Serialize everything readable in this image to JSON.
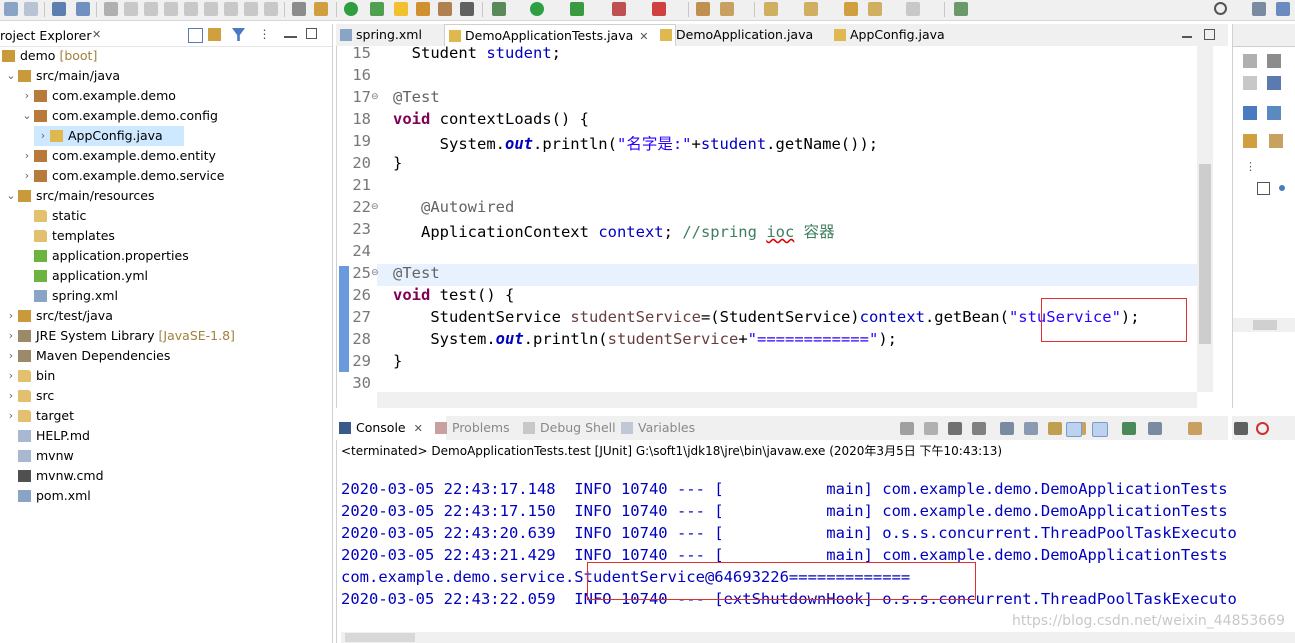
{
  "project_explorer": {
    "title": "roject Explorer",
    "tree": [
      {
        "label": "demo",
        "extra": "[boot]",
        "icon": "project-icon",
        "chev": "⌄"
      },
      {
        "label": "src/main/java",
        "extra": "",
        "icon": "source-folder-icon",
        "chev": "⌄"
      },
      {
        "label": "com.example.demo",
        "extra": "",
        "icon": "package-icon",
        "chev": "›"
      },
      {
        "label": "com.example.demo.config",
        "extra": "",
        "icon": "package-icon",
        "chev": "⌄"
      },
      {
        "label": "AppConfig.java",
        "extra": "",
        "icon": "java-file-icon",
        "chev": "›"
      },
      {
        "label": "com.example.demo.entity",
        "extra": "",
        "icon": "package-icon",
        "chev": "›"
      },
      {
        "label": "com.example.demo.service",
        "extra": "",
        "icon": "package-icon",
        "chev": "›"
      },
      {
        "label": "src/main/resources",
        "extra": "",
        "icon": "source-folder-icon",
        "chev": "⌄"
      },
      {
        "label": "static",
        "extra": "",
        "icon": "folder-icon",
        "chev": ""
      },
      {
        "label": "templates",
        "extra": "",
        "icon": "folder-icon",
        "chev": ""
      },
      {
        "label": "application.properties",
        "extra": "",
        "icon": "spring-leaf-icon",
        "chev": ""
      },
      {
        "label": "application.yml",
        "extra": "",
        "icon": "spring-leaf-icon",
        "chev": ""
      },
      {
        "label": "spring.xml",
        "extra": "",
        "icon": "xml-file-icon",
        "chev": ""
      },
      {
        "label": "src/test/java",
        "extra": "",
        "icon": "source-folder-icon",
        "chev": "›"
      },
      {
        "label": "JRE System Library",
        "extra": "[JavaSE-1.8]",
        "icon": "library-icon",
        "chev": "›"
      },
      {
        "label": "Maven Dependencies",
        "extra": "",
        "icon": "library-icon",
        "chev": "›"
      },
      {
        "label": "bin",
        "extra": "",
        "icon": "folder-icon",
        "chev": "›"
      },
      {
        "label": "src",
        "extra": "",
        "icon": "folder-icon",
        "chev": "›"
      },
      {
        "label": "target",
        "extra": "",
        "icon": "folder-icon",
        "chev": "›"
      },
      {
        "label": "HELP.md",
        "extra": "",
        "icon": "file-icon",
        "chev": ""
      },
      {
        "label": "mvnw",
        "extra": "",
        "icon": "file-icon",
        "chev": ""
      },
      {
        "label": "mvnw.cmd",
        "extra": "",
        "icon": "cmd-file-icon",
        "chev": ""
      },
      {
        "label": "pom.xml",
        "extra": "",
        "icon": "xml-file-icon",
        "chev": ""
      }
    ]
  },
  "editor": {
    "tabs": [
      {
        "label": "spring.xml"
      },
      {
        "label": "DemoApplicationTests.java",
        "close": "✕"
      },
      {
        "label": "DemoApplication.java"
      },
      {
        "label": "AppConfig.java"
      }
    ],
    "line_numbers": [
      "15",
      "16",
      "17",
      "18",
      "19",
      "20",
      "21",
      "22",
      "23",
      "24",
      "25",
      "26",
      "27",
      "28",
      "29",
      "30"
    ]
  },
  "console": {
    "tabs": [
      {
        "label": "Console"
      },
      {
        "label": "Problems"
      },
      {
        "label": "Debug Shell"
      },
      {
        "label": "Variables"
      }
    ],
    "status": "<terminated> DemoApplicationTests.test [JUnit] G:\\soft1\\jdk18\\jre\\bin\\javaw.exe (2020年3月5日 下午10:43:13)",
    "lines": [
      "2020-03-05 22:43:17.148  INFO 10740 --- [           main] com.example.demo.DemoApplicationTests",
      "2020-03-05 22:43:17.150  INFO 10740 --- [           main] com.example.demo.DemoApplicationTests",
      "2020-03-05 22:43:20.639  INFO 10740 --- [           main] o.s.s.concurrent.ThreadPoolTaskExecuto",
      "2020-03-05 22:43:21.429  INFO 10740 --- [           main] com.example.demo.DemoApplicationTests",
      "com.example.demo.service.StudentService@64693226=============",
      "2020-03-05 22:43:22.059  INFO 10740 --- [extShutdownHook] o.s.s.concurrent.ThreadPoolTaskExecuto"
    ]
  },
  "watermark": "https://blog.csdn.net/weixin_44853669",
  "colors": {
    "keyword": "#7f0055",
    "string": "#2a00ff",
    "field": "#0000c0",
    "comment": "#3f7f5f",
    "annotation": "#646464",
    "highlight_box": "#e03030"
  }
}
